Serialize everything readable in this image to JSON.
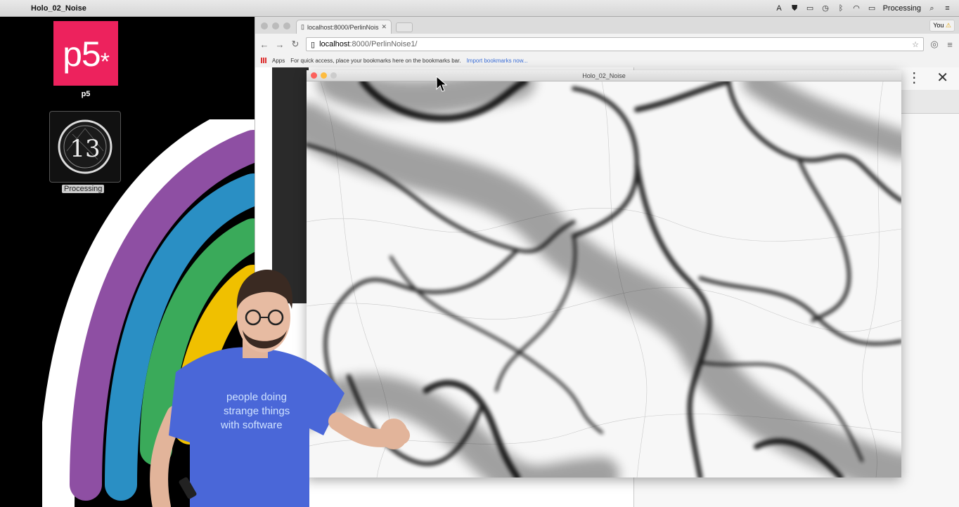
{
  "menubar": {
    "app_name": "Holo_02_Noise",
    "right_app": "Processing"
  },
  "desktop": {
    "p5_logo_text": "p5",
    "p5_logo_mark": "*",
    "p5_label": "p5",
    "processing_label": "Processing"
  },
  "browser": {
    "tab_title": "localhost:8000/PerlinNois",
    "profile_label": "You",
    "url_host": "localhost",
    "url_path": ":8000/PerlinNoise1/",
    "bookmarks_apps": "Apps",
    "bookmarks_hint": "For quick access, place your bookmarks here on the bookmarks bar.",
    "bookmarks_link": "Import bookmarks now..."
  },
  "sketch": {
    "title": "Holo_02_Noise"
  },
  "shirt_text": [
    "people doing",
    "strange things",
    "with software"
  ],
  "colors": {
    "p5_brand": "#ed225d",
    "rainbow": [
      "#8e4fa3",
      "#2a8fc4",
      "#3aaa5a",
      "#f0c000"
    ]
  }
}
